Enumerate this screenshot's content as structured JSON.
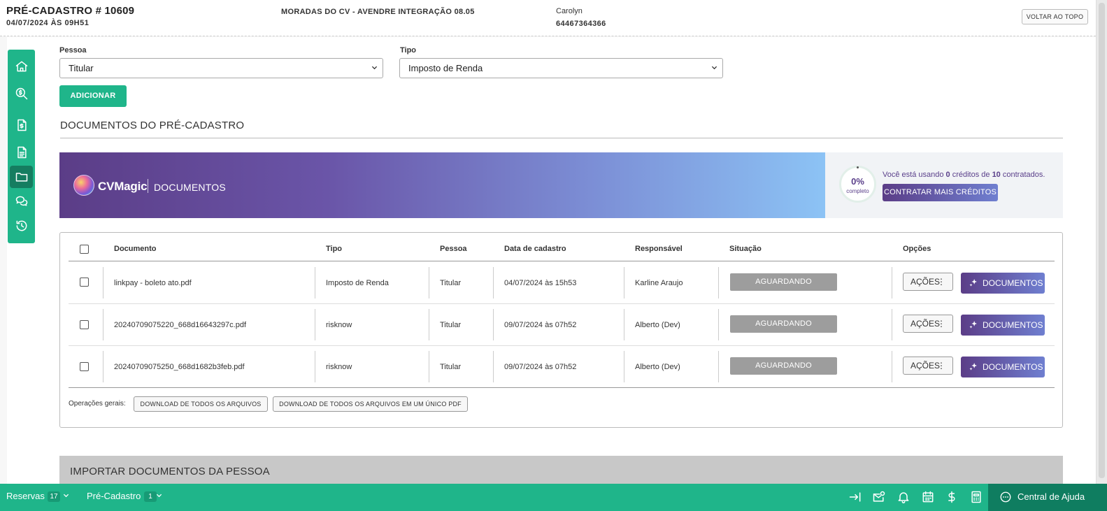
{
  "header": {
    "title": "PRÉ-CADASTRO # 10609",
    "subtitle": "04/07/2024 ÀS 09H51",
    "project": "MORADAS DO CV - AVENDRE INTEGRAÇÃO 08.05",
    "user_name": "Carolyn",
    "user_phone": "64467364366",
    "back_to_top_label": "VOLTAR AO TOPO"
  },
  "sidebar": {
    "items": [
      {
        "icon": "home-icon"
      },
      {
        "icon": "money-search-icon"
      },
      {
        "icon": "invoice-icon"
      },
      {
        "icon": "document-icon"
      },
      {
        "icon": "folder-icon",
        "active": true
      },
      {
        "icon": "chat-icon"
      },
      {
        "icon": "history-icon"
      }
    ]
  },
  "form": {
    "pessoa_label": "Pessoa",
    "pessoa_value": "Titular",
    "tipo_label": "Tipo",
    "tipo_value": "Imposto de Renda",
    "add_button": "ADICIONAR"
  },
  "section_title": "DOCUMENTOS DO PRÉ-CADASTRO",
  "banner": {
    "brand": "CVMagic",
    "module": "DOCUMENTOS",
    "progress_percent": 0,
    "progress_text": "0%",
    "progress_caption": "completo",
    "usage_prefix": "Você está usando ",
    "used_credits": "0",
    "usage_middle": " créditos de ",
    "total_credits": "10",
    "usage_suffix": " contratados.",
    "buy_button": "CONTRATAR MAIS CRÉDITOS"
  },
  "table": {
    "columns": {
      "documento": "Documento",
      "tipo": "Tipo",
      "pessoa": "Pessoa",
      "data": "Data de cadastro",
      "responsavel": "Responsável",
      "situacao": "Situação",
      "opcoes": "Opções"
    },
    "rows": [
      {
        "documento": "linkpay - boleto ato.pdf",
        "tipo": "Imposto de Renda",
        "pessoa": "Titular",
        "data": "04/07/2024 às 15h53",
        "responsavel": "Karline Araujo",
        "situacao": "AGUARDANDO APROVAÇÃO",
        "acoes": "AÇÕES",
        "docs": "DOCUMENTOS"
      },
      {
        "documento": "20240709075220_668d16643297c.pdf",
        "tipo": "risknow",
        "pessoa": "Titular",
        "data": "09/07/2024 às 07h52",
        "responsavel": "Alberto (Dev)",
        "situacao": "AGUARDANDO APROVAÇÃO",
        "acoes": "AÇÕES",
        "docs": "DOCUMENTOS"
      },
      {
        "documento": "20240709075250_668d1682b3feb.pdf",
        "tipo": "risknow",
        "pessoa": "Titular",
        "data": "09/07/2024 às 07h52",
        "responsavel": "Alberto (Dev)",
        "situacao": "AGUARDANDO APROVAÇÃO",
        "acoes": "AÇÕES",
        "docs": "DOCUMENTOS"
      }
    ],
    "operations_label": "Operações gerais:",
    "download_all": "DOWNLOAD DE TODOS OS ARQUIVOS",
    "download_pdf": "DOWNLOAD DE TODOS OS ARQUIVOS EM UM ÚNICO PDF"
  },
  "import_section": "IMPORTAR DOCUMENTOS DA PESSOA",
  "bottombar": {
    "reservas_label": "Reservas",
    "reservas_count": "17",
    "precadastro_label": "Pré-Cadastro",
    "precadastro_count": "1",
    "icons": [
      "collapse-right-icon",
      "mail-badge-icon",
      "bell-icon",
      "calendar-icon",
      "dollar-icon",
      "calculator-icon"
    ],
    "help_label": "Central de Ajuda"
  },
  "colors": {
    "primary_green": "#1fb58a",
    "dark_green": "#0f7d60",
    "brand_purple": "#5b3d87",
    "status_gray": "#9d9d9d"
  }
}
